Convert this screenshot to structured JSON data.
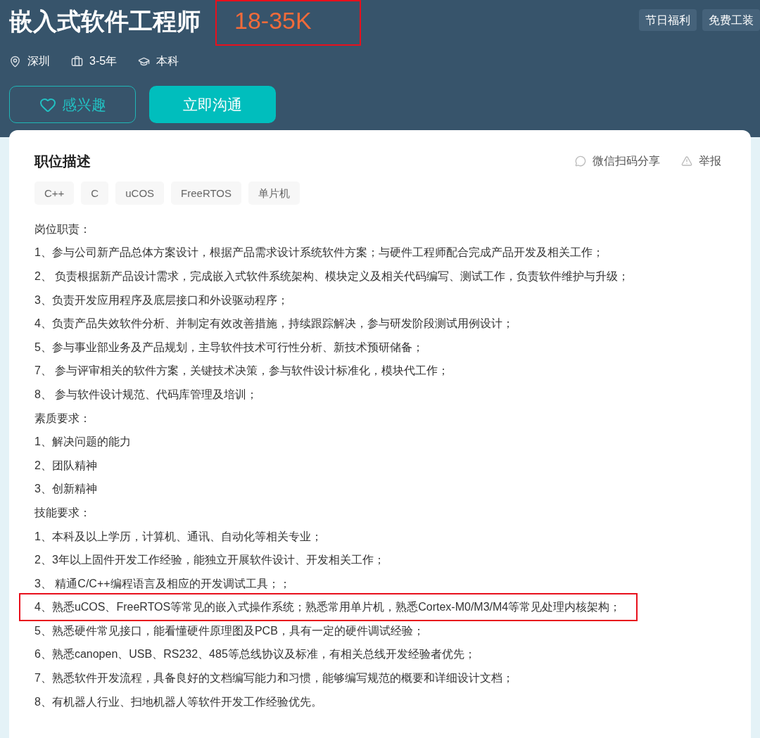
{
  "job": {
    "title": "嵌入式软件工程师",
    "salary": "18-35K",
    "salary_highlighted": true,
    "meta": [
      {
        "kind": "location",
        "text": "深圳"
      },
      {
        "kind": "experience",
        "text": "3-5年"
      },
      {
        "kind": "education",
        "text": "本科"
      }
    ],
    "benefits": [
      "节日福利",
      "免费工装"
    ],
    "buttons": [
      {
        "kind": "interest",
        "label": "感兴趣"
      },
      {
        "kind": "chat",
        "label": "立即沟通"
      }
    ]
  },
  "description": {
    "title": "职位描述",
    "actions": [
      {
        "kind": "share",
        "label": "微信扫码分享"
      },
      {
        "kind": "report",
        "label": "举报"
      }
    ],
    "skills": [
      "C++",
      "C",
      "uCOS",
      "FreeRTOS",
      "单片机"
    ],
    "lines": [
      {
        "text": "岗位职责：",
        "highlighted": false
      },
      {
        "text": "1、参与公司新产品总体方案设计，根据产品需求设计系统软件方案；与硬件工程师配合完成产品开发及相关工作；",
        "highlighted": false
      },
      {
        "text": "2、 负责根据新产品设计需求，完成嵌入式软件系统架构、模块定义及相关代码编写、测试工作，负责软件维护与升级；",
        "highlighted": false
      },
      {
        "text": "3、负责开发应用程序及底层接口和外设驱动程序；",
        "highlighted": false
      },
      {
        "text": "4、负责产品失效软件分析、并制定有效改善措施，持续跟踪解决，参与研发阶段测试用例设计；",
        "highlighted": false
      },
      {
        "text": "5、参与事业部业务及产品规划，主导软件技术可行性分析、新技术预研储备；",
        "highlighted": false
      },
      {
        "text": "7、 参与评审相关的软件方案，关键技术决策，参与软件设计标准化，模块代工作；",
        "highlighted": false
      },
      {
        "text": "8、 参与软件设计规范、代码库管理及培训；",
        "highlighted": false
      },
      {
        "text": "素质要求：",
        "highlighted": false
      },
      {
        "text": "1、解决问题的能力",
        "highlighted": false
      },
      {
        "text": "2、团队精神",
        "highlighted": false
      },
      {
        "text": "3、创新精神",
        "highlighted": false
      },
      {
        "text": "技能要求：",
        "highlighted": false
      },
      {
        "text": "1、本科及以上学历，计算机、通讯、自动化等相关专业；",
        "highlighted": false
      },
      {
        "text": "2、3年以上固件开发工作经验，能独立开展软件设计、开发相关工作；",
        "highlighted": false
      },
      {
        "text": "3、 精通C/C++编程语言及相应的开发调试工具；；",
        "highlighted": false
      },
      {
        "text": "4、熟悉uCOS、FreeRTOS等常见的嵌入式操作系统；熟悉常用单片机，熟悉Cortex-M0/M3/M4等常见处理内核架构；",
        "highlighted": true
      },
      {
        "text": "5、熟悉硬件常见接口，能看懂硬件原理图及PCB，具有一定的硬件调试经验；",
        "highlighted": false
      },
      {
        "text": "6、熟悉canopen、USB、RS232、485等总线协议及标准，有相关总线开发经验者优先；",
        "highlighted": false
      },
      {
        "text": "7、熟悉软件开发流程，具备良好的文档编写能力和习惯，能够编写规范的概要和详细设计文档；",
        "highlighted": false
      },
      {
        "text": "8、有机器人行业、扫地机器人等软件开发工作经验优先。",
        "highlighted": false
      }
    ]
  }
}
